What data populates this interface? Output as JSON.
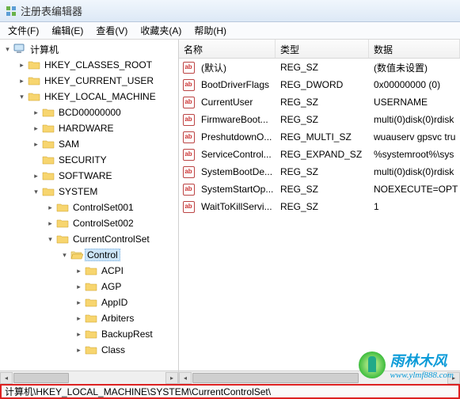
{
  "window": {
    "title": "注册表编辑器"
  },
  "menu": {
    "file": "文件(F)",
    "edit": "编辑(E)",
    "view": "查看(V)",
    "favorites": "收藏夹(A)",
    "help": "帮助(H)"
  },
  "tree": {
    "root": "计算机",
    "hkcr": "HKEY_CLASSES_ROOT",
    "hkcu": "HKEY_CURRENT_USER",
    "hklm": "HKEY_LOCAL_MACHINE",
    "bcd": "BCD00000000",
    "hardware": "HARDWARE",
    "sam": "SAM",
    "security": "SECURITY",
    "software": "SOFTWARE",
    "system": "SYSTEM",
    "cs001": "ControlSet001",
    "cs002": "ControlSet002",
    "ccs": "CurrentControlSet",
    "control": "Control",
    "acpi": "ACPI",
    "agp": "AGP",
    "appid": "AppID",
    "arbiters": "Arbiters",
    "backuprest": "BackupRest",
    "class": "Class"
  },
  "list": {
    "headers": {
      "name": "名称",
      "type": "类型",
      "data": "数据"
    },
    "rows": [
      {
        "icon": "ab",
        "name": "(默认)",
        "type": "REG_SZ",
        "data": "(数值未设置)"
      },
      {
        "icon": "ab",
        "name": "BootDriverFlags",
        "type": "REG_DWORD",
        "data": "0x00000000 (0)"
      },
      {
        "icon": "ab",
        "name": "CurrentUser",
        "type": "REG_SZ",
        "data": "USERNAME"
      },
      {
        "icon": "ab",
        "name": "FirmwareBoot...",
        "type": "REG_SZ",
        "data": "multi(0)disk(0)rdisk"
      },
      {
        "icon": "ab",
        "name": "PreshutdownO...",
        "type": "REG_MULTI_SZ",
        "data": "wuauserv gpsvc tru"
      },
      {
        "icon": "ab",
        "name": "ServiceControl...",
        "type": "REG_EXPAND_SZ",
        "data": "%systemroot%\\sys"
      },
      {
        "icon": "ab",
        "name": "SystemBootDe...",
        "type": "REG_SZ",
        "data": "multi(0)disk(0)rdisk"
      },
      {
        "icon": "ab",
        "name": "SystemStartOp...",
        "type": "REG_SZ",
        "data": " NOEXECUTE=OPT"
      },
      {
        "icon": "ab",
        "name": "WaitToKillServi...",
        "type": "REG_SZ",
        "data": "1"
      }
    ]
  },
  "status": {
    "path": "计算机\\HKEY_LOCAL_MACHINE\\SYSTEM\\CurrentControlSet\\"
  },
  "watermark": {
    "cn": "雨林木风",
    "en": "www.ylmf888.com"
  },
  "icons": {
    "ab": "ab"
  }
}
